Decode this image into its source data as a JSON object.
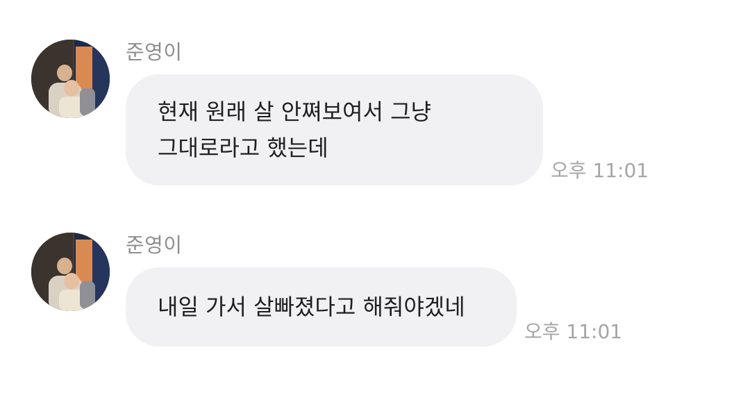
{
  "messages": [
    {
      "sender": "준영이",
      "text": "현재 원래 살 안쪄보여서 그냥\n그대로라고 했는데",
      "time": "오후 11:01"
    },
    {
      "sender": "준영이",
      "text": "내일 가서 살빠졌다고 해줘야겠네",
      "time": "오후 11:01"
    }
  ],
  "colors": {
    "bubble_background": "#f1f1f3",
    "sender_name": "#8e8e8e",
    "timestamp": "#a5a5a5",
    "message_text": "#1f1f1f"
  }
}
